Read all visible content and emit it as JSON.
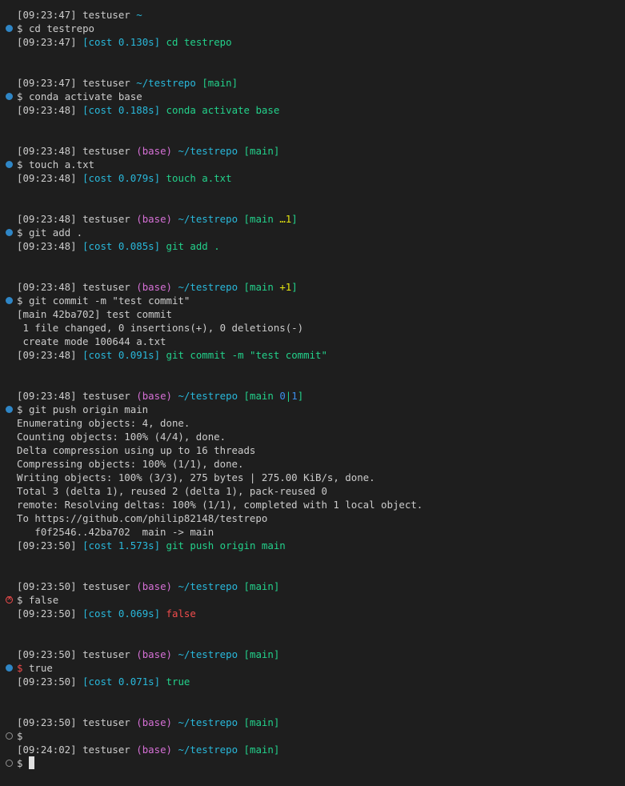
{
  "user": "testuser",
  "dir_home": "~",
  "dir_repo": "~/testrepo",
  "env": "(base)",
  "prompt_symbol": "$",
  "cost_label": "[cost",
  "blocks": [
    {
      "time": "[09:23:47]",
      "dir": "~",
      "command": "cd testrepo",
      "cost_time": "[09:23:47]",
      "cost": "0.130s]",
      "cost_cmd": "cd testrepo"
    },
    {
      "time": "[09:23:47]",
      "dir": "~/testrepo",
      "branch": "[main]",
      "command": "conda activate base",
      "cost_time": "[09:23:48]",
      "cost": "0.188s]",
      "cost_cmd": "conda activate base"
    },
    {
      "time": "[09:23:48]",
      "branch": "[main]",
      "command": "touch a.txt",
      "cost_time": "[09:23:48]",
      "cost": "0.079s]",
      "cost_cmd": "touch a.txt"
    },
    {
      "time": "[09:23:48]",
      "branch_open": "[main ",
      "branch_flag": "…1",
      "branch_close": "]",
      "command": "git add .",
      "cost_time": "[09:23:48]",
      "cost": "0.085s]",
      "cost_cmd": "git add ."
    },
    {
      "time": "[09:23:48]",
      "branch_open": "[main ",
      "branch_flag": "+1",
      "branch_close": "]",
      "command": "git commit -m \"test commit\"",
      "output": [
        "[main 42ba702] test commit",
        " 1 file changed, 0 insertions(+), 0 deletions(-)",
        " create mode 100644 a.txt"
      ],
      "cost_time": "[09:23:48]",
      "cost": "0.091s]",
      "cost_cmd": "git commit -m \"test commit\""
    },
    {
      "time": "[09:23:48]",
      "branch_open": "[main ",
      "branch_a": "0",
      "branch_sep": "|",
      "branch_b": "1",
      "branch_close": "]",
      "command": "git push origin main",
      "output": [
        "Enumerating objects: 4, done.",
        "Counting objects: 100% (4/4), done.",
        "Delta compression using up to 16 threads",
        "Compressing objects: 100% (1/1), done.",
        "Writing objects: 100% (3/3), 275 bytes | 275.00 KiB/s, done.",
        "Total 3 (delta 1), reused 2 (delta 1), pack-reused 0",
        "remote: Resolving deltas: 100% (1/1), completed with 1 local object.",
        "To https://github.com/philip82148/testrepo",
        "   f0f2546..42ba702  main -> main"
      ],
      "cost_time": "[09:23:50]",
      "cost": "1.573s]",
      "cost_cmd": "git push origin main"
    },
    {
      "time": "[09:23:50]",
      "branch": "[main]",
      "command": "false",
      "cost_time": "[09:23:50]",
      "cost": "0.069s]",
      "cost_cmd": "false"
    },
    {
      "time": "[09:23:50]",
      "branch": "[main]",
      "command": "true",
      "cost_time": "[09:23:50]",
      "cost": "0.071s]",
      "cost_cmd": "true"
    },
    {
      "time": "[09:23:50]",
      "branch": "[main]"
    },
    {
      "time": "[09:24:02]",
      "branch": "[main]"
    }
  ]
}
